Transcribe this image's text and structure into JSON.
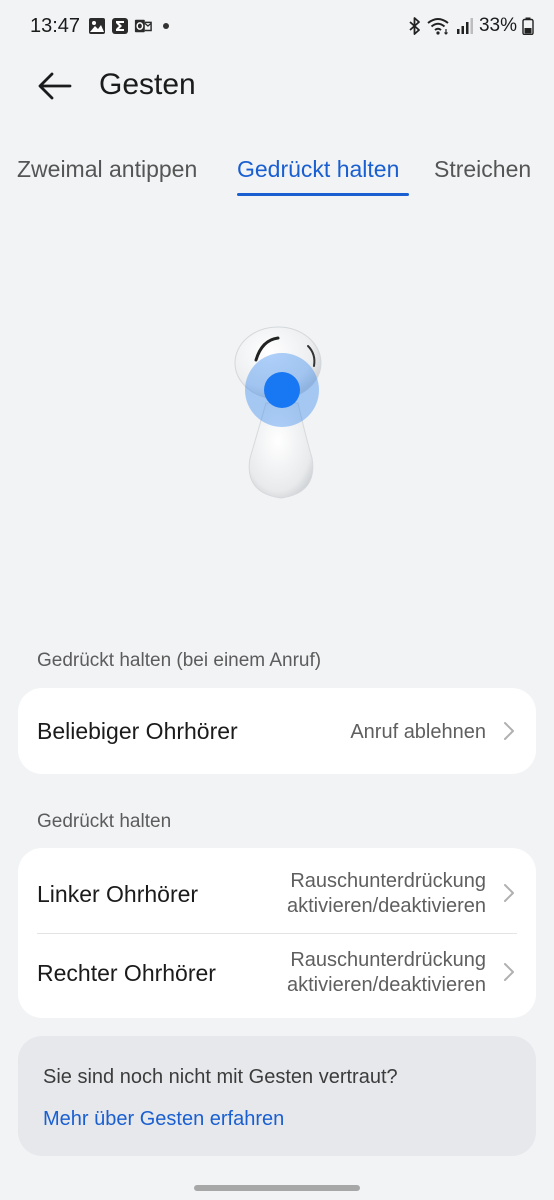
{
  "status_bar": {
    "time": "13:47",
    "battery": "33%",
    "left_icons": [
      "image-icon",
      "sigma-icon",
      "outlook-icon",
      "dot-icon"
    ],
    "right_icons": [
      "bluetooth-icon",
      "wifi-icon",
      "signal-icon",
      "battery-icon"
    ]
  },
  "header": {
    "title": "Gesten",
    "back_icon": "back-arrow-icon"
  },
  "tabs": [
    {
      "label": "Zweimal antippen",
      "active": false
    },
    {
      "label": "Gedrückt halten",
      "active": true
    },
    {
      "label": "Streichen",
      "active": false
    }
  ],
  "illustration": {
    "icon": "earbud-icon",
    "accent_color": "#1877f2"
  },
  "section_call": {
    "label": "Gedrückt halten (bei einem Anruf)",
    "rows": [
      {
        "title": "Beliebiger Ohrhörer",
        "value": "Anruf ablehnen"
      }
    ]
  },
  "section_hold": {
    "label": "Gedrückt halten",
    "rows": [
      {
        "title": "Linker Ohrhörer",
        "value_line1": "Rauschunterdrückung",
        "value_line2": "aktivieren/deaktivieren"
      },
      {
        "title": "Rechter Ohrhörer",
        "value_line1": "Rauschunterdrückung",
        "value_line2": "aktivieren/deaktivieren"
      }
    ]
  },
  "info": {
    "text": "Sie sind noch nicht mit Gesten vertraut?",
    "link": "Mehr über Gesten erfahren"
  },
  "colors": {
    "accent": "#1a5fd1",
    "background": "#f1f3f5",
    "card": "#ffffff"
  }
}
